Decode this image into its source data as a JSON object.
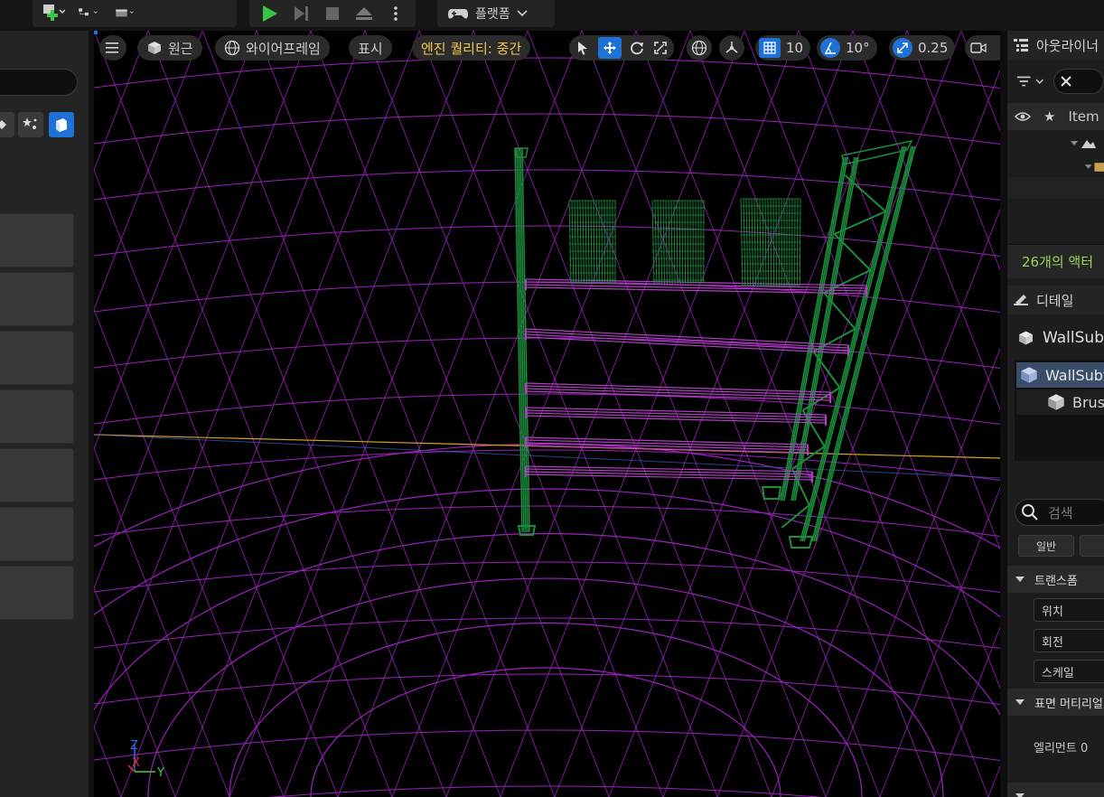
{
  "toolbar": {
    "platform_label": "플랫폼"
  },
  "viewport": {
    "perspective_label": "원근",
    "wireframe_label": "와이어프레임",
    "show_label": "표시",
    "quality_label": "엔진 퀄리티: 중간",
    "grid_snap_value": "10",
    "rotate_snap_value": "10°",
    "scale_snap_value": "0.25",
    "axis": {
      "z": "Z",
      "x": "X",
      "y": "Y"
    }
  },
  "outliner": {
    "title": "아웃라이너",
    "column_label": "Item",
    "actor_count": "26개의 액터"
  },
  "details": {
    "title": "디테일",
    "actor_name": "WallSub",
    "component_root": "WallSubt",
    "component_child": "Brus",
    "search_placeholder": "검색",
    "filter_general": "일반",
    "cat_transform": "트랜스폼",
    "prop_location": "위치",
    "prop_rotation": "회전",
    "prop_scale": "스케일",
    "cat_material": "표면 머티리얼",
    "element0_label": "엘리먼트 0"
  },
  "colors": {
    "accent_blue": "#1e72d6",
    "grid_magenta": "#a020c0",
    "mesh_green": "#1a8f3c",
    "beam_purple": "#b040c0",
    "actor_count_green": "#9bd35a",
    "quality_yellow": "#f2c94c"
  }
}
